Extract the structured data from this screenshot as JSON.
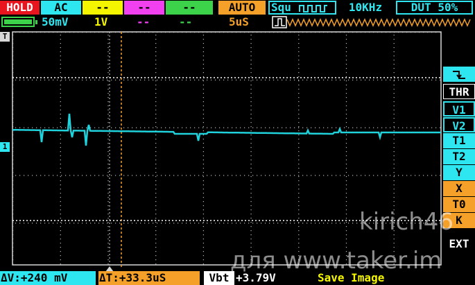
{
  "colors": {
    "red": "#e8141e",
    "cyan": "#2ee6f0",
    "yellow": "#f5f500",
    "magenta": "#f040f0",
    "green": "#3cd24a",
    "orange": "#f5a028",
    "white": "#ffffff",
    "trace": "#20d2dc"
  },
  "top": {
    "hold": "HOLD",
    "coupling": "AC",
    "ch_yellow": "--",
    "ch_magenta": "--",
    "ch_green": "--",
    "trigger_mode": "AUTO",
    "waveform": "Squ",
    "frequency": "10KHz",
    "duty": "DUT 50%"
  },
  "second": {
    "volts_div": "50mV",
    "ch_yellow_div": "1V",
    "ch_magenta_div": "--",
    "ch_green_div": "--",
    "time_div": "5uS"
  },
  "markers": {
    "trigger_marker": "T",
    "channel_marker": "1"
  },
  "menu": [
    "THR",
    "V1",
    "V2",
    "T1",
    "T2",
    "Y",
    "X",
    "T0",
    "K",
    "EXT"
  ],
  "bottom": {
    "delta_v": "ΔV:+240 mV",
    "delta_t": "ΔT:+33.3uS",
    "vbt_label": "Vbt",
    "vbt_value": "+3.79V",
    "save": "Save Image"
  },
  "watermark": {
    "author": "kirich46",
    "site": "для www.taker.im"
  }
}
